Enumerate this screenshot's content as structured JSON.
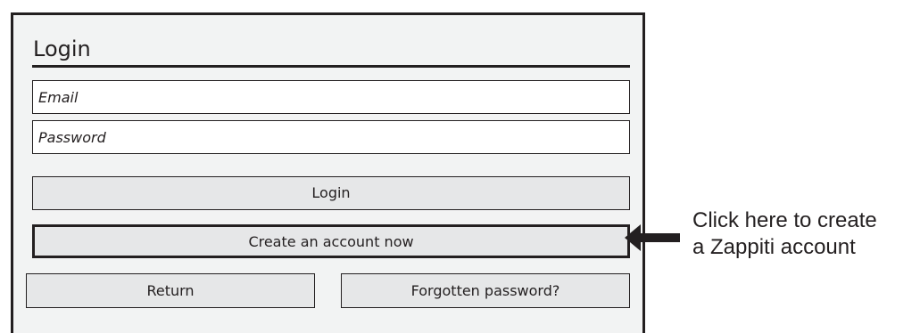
{
  "login_panel": {
    "title": "Login",
    "email": {
      "placeholder": "Email"
    },
    "password": {
      "placeholder": "Password"
    },
    "login_button": "Login",
    "create_account_button": "Create an account now",
    "return_button": "Return",
    "forgotten_password_button": "Forgotten password?"
  },
  "annotation": {
    "line1": "Click here to create",
    "line2": "a Zappiti account",
    "arrow_icon": "left-arrow-icon"
  },
  "colors": {
    "border": "#231f20",
    "panel_bg": "#f2f3f3",
    "button_bg": "#e6e7e8",
    "field_bg": "#ffffff"
  }
}
